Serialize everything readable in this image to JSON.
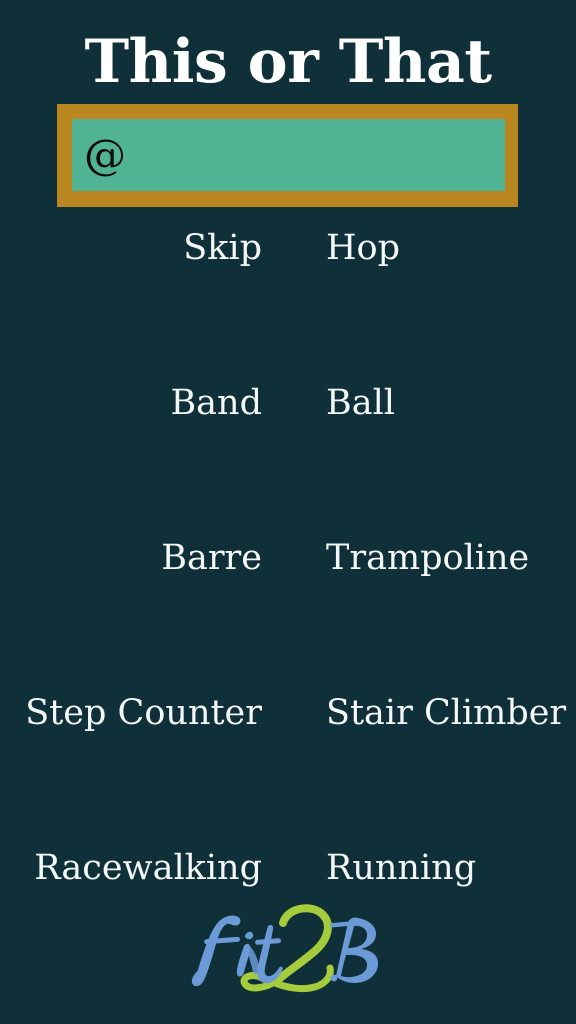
{
  "page": {
    "background_color": "#0f3038",
    "title": "This or That"
  },
  "input": {
    "value": "@",
    "placeholder": "",
    "frame_color": "#b9861f",
    "field_color": "#4fb394",
    "text_color": "#0a0a0a"
  },
  "options": {
    "text_color": "#f4f7f7",
    "rows": [
      {
        "left": "Skip",
        "right": "Hop"
      },
      {
        "left": "Band",
        "right": "Ball"
      },
      {
        "left": "Barre",
        "right": "Trampoline"
      },
      {
        "left": "Step Counter",
        "right": "Stair Climber"
      },
      {
        "left": "Racewalking",
        "right": "Running"
      }
    ]
  },
  "logo": {
    "name": "fit2b-logo",
    "text": "Fit2B",
    "part_fit": "Fit",
    "part_two": "2",
    "part_b": "B",
    "blue": "#6b9ad6",
    "green": "#a4cc3c"
  }
}
